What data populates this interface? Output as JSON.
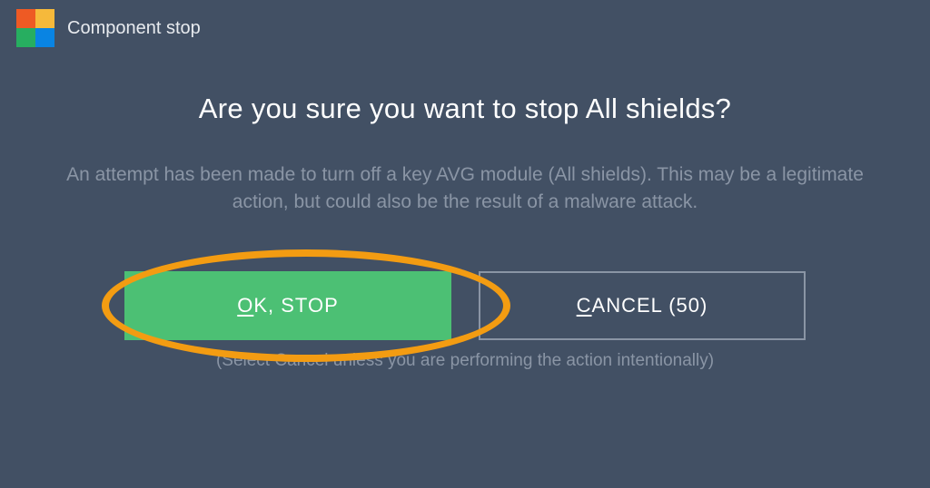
{
  "titlebar": {
    "title": "Component stop"
  },
  "dialog": {
    "heading": "Are you sure you want to stop All shields?",
    "body": "An attempt has been made to turn off a key AVG module (All shields). This may be a legitimate action, but could also be the result of a malware attack.",
    "footnote": "(Select Cancel unless you are performing the action intentionally)"
  },
  "buttons": {
    "ok": {
      "prefix": "O",
      "rest": "K, STOP"
    },
    "cancel": {
      "prefix": "C",
      "rest": "ANCEL (50)"
    }
  },
  "colors": {
    "bg": "#425064",
    "primary": "#4cc074",
    "highlight": "#f39c12"
  }
}
